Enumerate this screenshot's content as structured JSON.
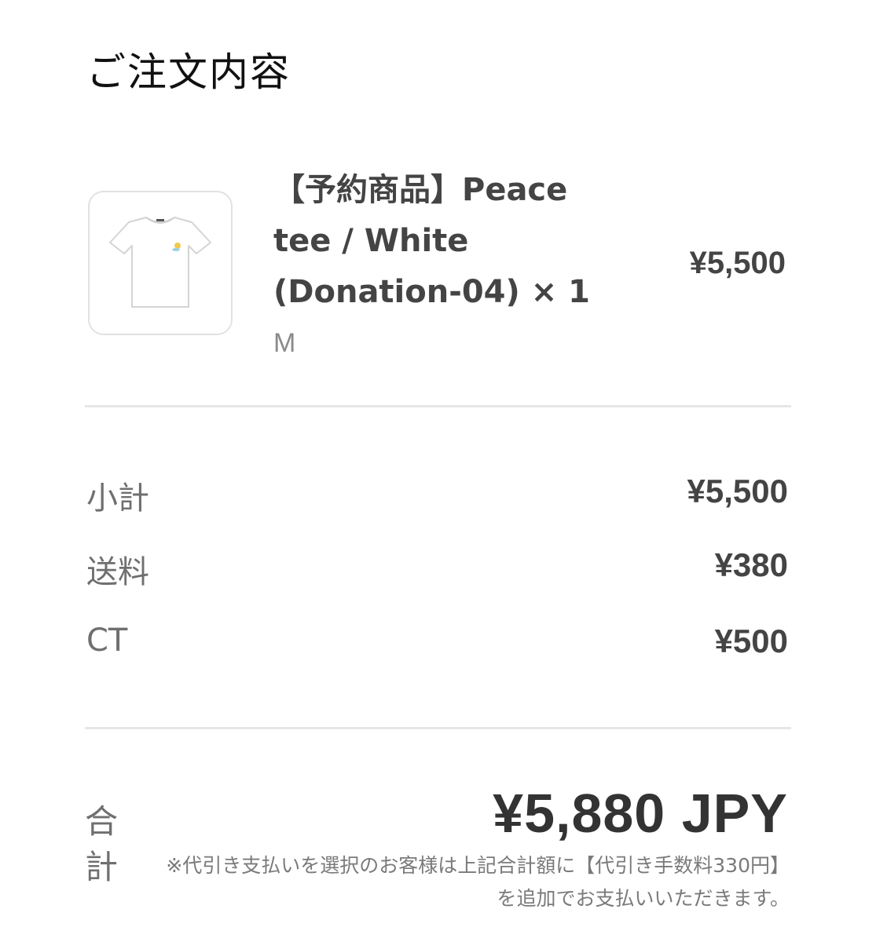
{
  "header": {
    "title": "ご注文内容"
  },
  "item": {
    "image_icon": "tshirt-icon",
    "name": "【予約商品】Peace tee / White (Donation-04) × 1",
    "variant": "M",
    "price": "¥5,500"
  },
  "summary": [
    {
      "label": "小計",
      "value": "¥5,500"
    },
    {
      "label": "送料",
      "value": "¥380"
    },
    {
      "label": "CT",
      "value": "¥500"
    }
  ],
  "total": {
    "label": "合計",
    "value": "¥5,880 JPY",
    "note": "※代引き支払いを選択のお客様は上記合計額に【代引き手数料330円】を追加でお支払いいただきます。"
  }
}
